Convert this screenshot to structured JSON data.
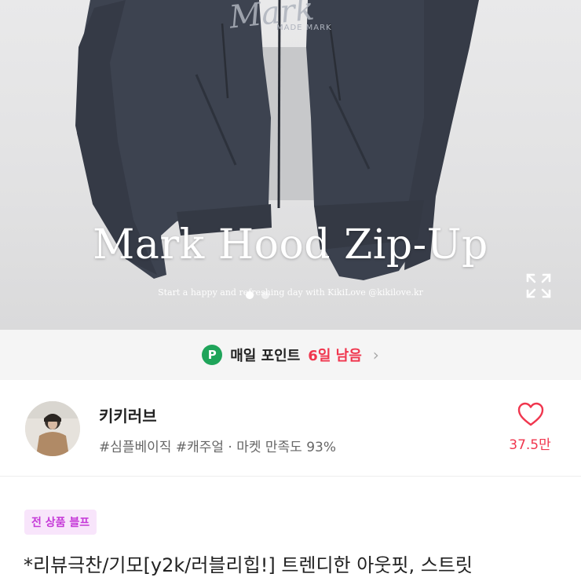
{
  "hero": {
    "title": "Mark Hood Zip-Up",
    "subtitle": "Start a happy and refreshing day with KikiLove @kikilove.kr",
    "garment_print": "Mark",
    "garment_sub_print": "MADE MARK",
    "slide_count": 2,
    "active_slide": 1
  },
  "points": {
    "icon_letter": "P",
    "label": "매일 포인트",
    "days_left": "6일 남음"
  },
  "store": {
    "name": "키키러브",
    "tags": "#심플베이직 #캐주얼 · 마켓 만족도 93%",
    "likes": "37.5만"
  },
  "product": {
    "badge": "전 상품 블프",
    "title": "*리뷰극찬/기모[y2k/러블리힙!] 트렌디한 아웃핏, 스트릿"
  },
  "colors": {
    "accent_red": "#f0364e",
    "point_green": "#1fa45a",
    "badge_bg": "#f8e5fb",
    "badge_text": "#c539d8",
    "hoodie": "#3d4350"
  },
  "icons": [
    "expand-icon",
    "point-icon",
    "chevron-right-icon",
    "heart-icon"
  ]
}
